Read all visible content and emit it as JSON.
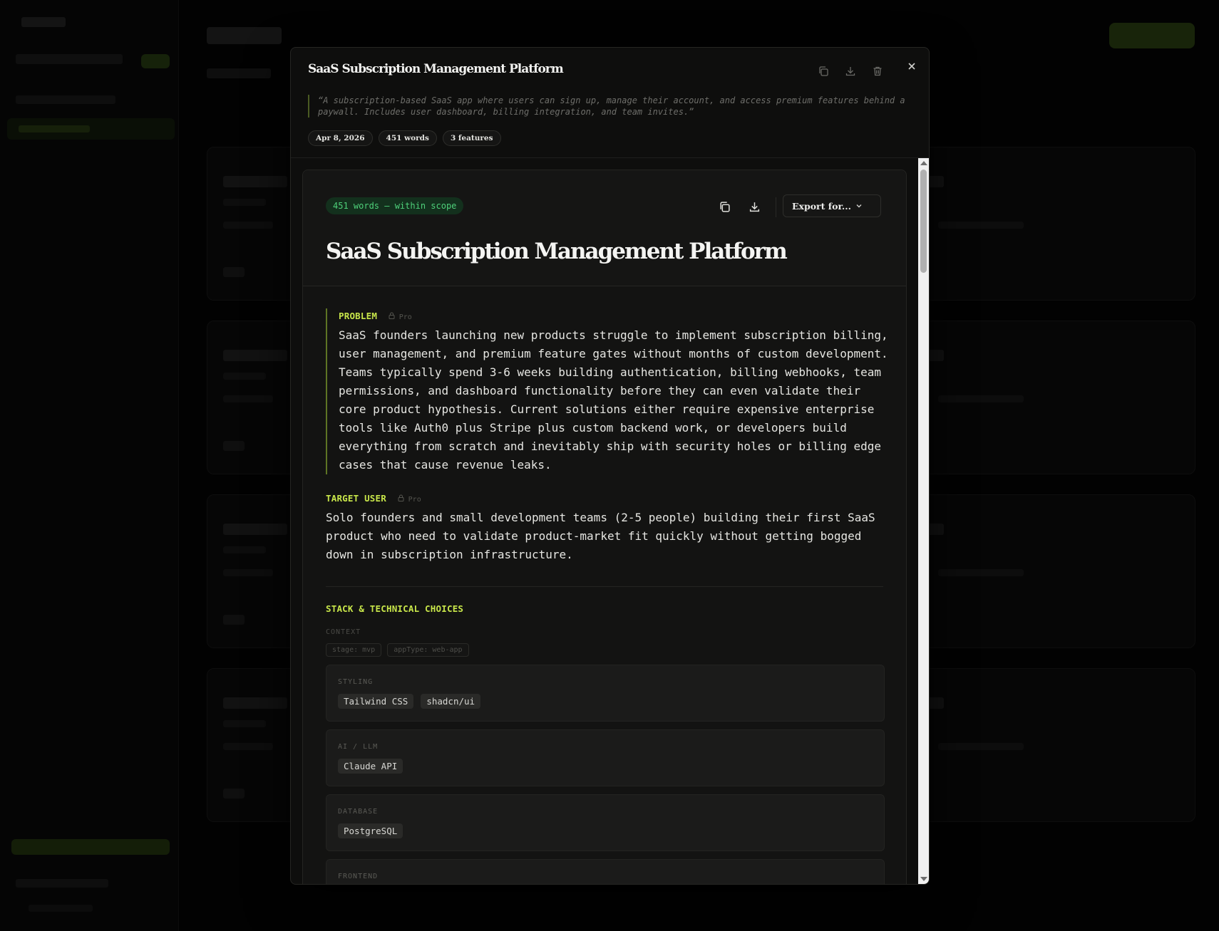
{
  "modal": {
    "title": "SaaS Subscription Management Platform",
    "prompt": "“A subscription-based SaaS app where users can sign up, manage their account, and access premium features behind a paywall. Includes user dashboard, billing integration, and team invites.”",
    "meta": {
      "date": "Apr 8, 2026",
      "words": "451 words",
      "features": "3 features"
    },
    "icons": [
      "copy-icon",
      "download-icon",
      "trash-icon",
      "close-icon"
    ]
  },
  "doc": {
    "scope_badge": "451 words — within scope",
    "export_label": "Export for...",
    "title": "SaaS Subscription Management Platform",
    "problem": {
      "label": "PROBLEM",
      "pro": "Pro",
      "text": "SaaS founders launching new products struggle to implement subscription billing, user management, and premium feature gates without months of custom development. Teams typically spend 3-6 weeks building authentication, billing webhooks, team permissions, and dashboard functionality before they can even validate their core product hypothesis. Current solutions either require expensive enterprise tools like Auth0 plus Stripe plus custom backend work, or developers build everything from scratch and inevitably ship with security holes or billing edge cases that cause revenue leaks."
    },
    "target_user": {
      "label": "TARGET USER",
      "pro": "Pro",
      "text": "Solo founders and small development teams (2-5 people) building their first SaaS product who need to validate product-market fit quickly without getting bogged down in subscription infrastructure."
    },
    "stack": {
      "label": "STACK & TECHNICAL CHOICES",
      "context_label": "CONTEXT",
      "context": [
        "stage: mvp",
        "appType: web-app"
      ],
      "categories": [
        {
          "name": "STYLING",
          "items": [
            "Tailwind CSS",
            "shadcn/ui"
          ]
        },
        {
          "name": "AI / LLM",
          "items": [
            "Claude API"
          ]
        },
        {
          "name": "DATABASE",
          "items": [
            "PostgreSQL"
          ]
        },
        {
          "name": "FRONTEND",
          "items": []
        }
      ]
    }
  },
  "colors": {
    "accent": "#c8e64a",
    "scope_green": "#4ed07a",
    "background": "#020202",
    "modal_bg": "#0e0e0d"
  }
}
